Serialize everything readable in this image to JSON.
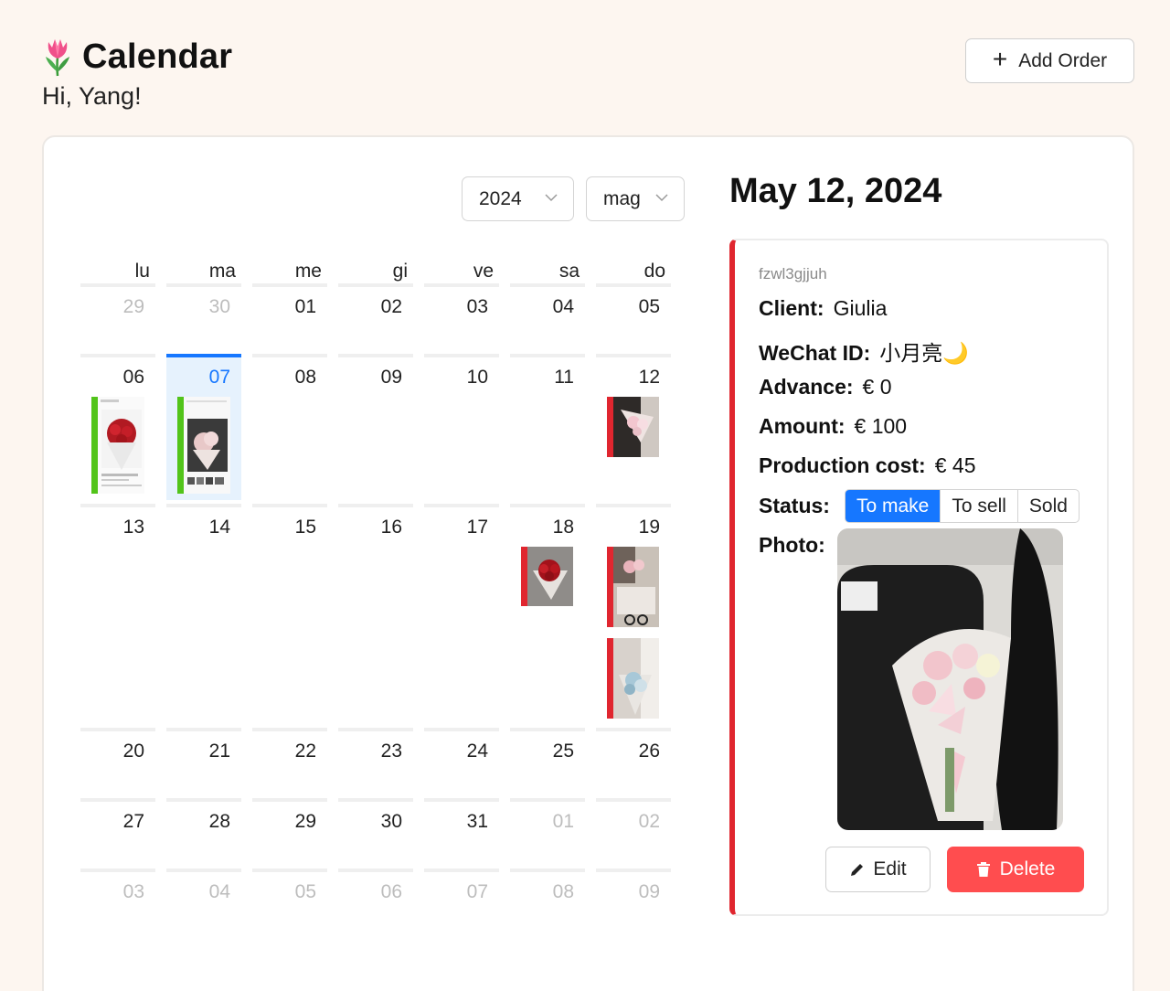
{
  "header": {
    "title": "Calendar",
    "greeting": "Hi, Yang!",
    "logo_icon": "tulip-icon"
  },
  "toolbar": {
    "add_label": "Add Order"
  },
  "calendar": {
    "year_select": "2024",
    "month_select": "mag",
    "weekdays": [
      "lu",
      "ma",
      "me",
      "gi",
      "ve",
      "sa",
      "do"
    ],
    "weeks": [
      [
        "29",
        "30",
        "01",
        "02",
        "03",
        "04",
        "05"
      ],
      [
        "06",
        "07",
        "08",
        "09",
        "10",
        "11",
        "12"
      ],
      [
        "13",
        "14",
        "15",
        "16",
        "17",
        "18",
        "19"
      ],
      [
        "20",
        "21",
        "22",
        "23",
        "24",
        "25",
        "26"
      ],
      [
        "27",
        "28",
        "29",
        "30",
        "31",
        "01",
        "02"
      ],
      [
        "03",
        "04",
        "05",
        "06",
        "07",
        "08",
        "09"
      ]
    ],
    "selected_day": "07",
    "status_colors": {
      "sold": "#52c41a",
      "to_make": "#e0262f"
    }
  },
  "detail": {
    "date": "May 12, 2024",
    "order_id": "fzwl3gjjuh",
    "client_label": "Client:",
    "client": "Giulia",
    "wechat_label": "WeChat ID:",
    "wechat": "小月亮🌙",
    "advance_label": "Advance:",
    "advance": "€ 0",
    "amount_label": "Amount:",
    "amount": "€ 100",
    "cost_label": "Production cost:",
    "cost": "€ 45",
    "status_label": "Status:",
    "status_options": [
      "To make",
      "To sell",
      "Sold"
    ],
    "status_selected": "To make",
    "photo_label": "Photo:",
    "edit_label": "Edit",
    "delete_label": "Delete"
  },
  "colors": {
    "accent": "#1677ff",
    "danger": "#ff4d4f",
    "page_bg": "#fdf6f0"
  }
}
